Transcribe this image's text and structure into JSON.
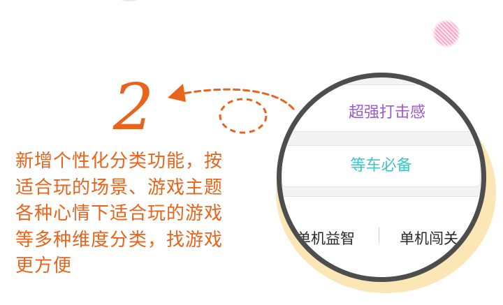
{
  "step": {
    "number": "2"
  },
  "feature_text": {
    "lines": [
      "新增个性化分类功能，按",
      "适合玩的场景、游戏主题",
      "各种心情下适合玩的游戏",
      "等多种维度分类，找游戏",
      "更方便"
    ]
  },
  "magnifier": {
    "categories": {
      "top": "超强打击感",
      "middle": "等车必备",
      "bottom_left": "单机益智",
      "bottom_right": "单机闯关"
    }
  },
  "colors": {
    "accent_orange": "#e8641b",
    "category_purple": "#9b59d0",
    "category_teal": "#3cc6c8",
    "lens_border": "#4d4d4d",
    "lens_shadow": "#fbe7b5"
  }
}
